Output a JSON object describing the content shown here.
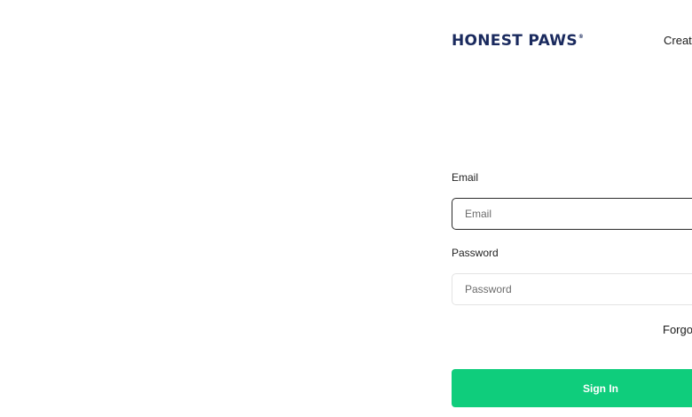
{
  "header": {
    "logo_text": "HONEST PAWS",
    "logo_mark": "®",
    "create_account_label": "Creat"
  },
  "form": {
    "email": {
      "label": "Email",
      "placeholder": "Email",
      "value": ""
    },
    "password": {
      "label": "Password",
      "placeholder": "Password",
      "value": ""
    },
    "forgot_label": "Forgo",
    "submit_label": "Sign In"
  },
  "colors": {
    "brand": "#1a2a5e",
    "primary_button": "#0fcd7c",
    "focused_border": "#2b2b2b",
    "input_border": "#e3e3e3"
  }
}
